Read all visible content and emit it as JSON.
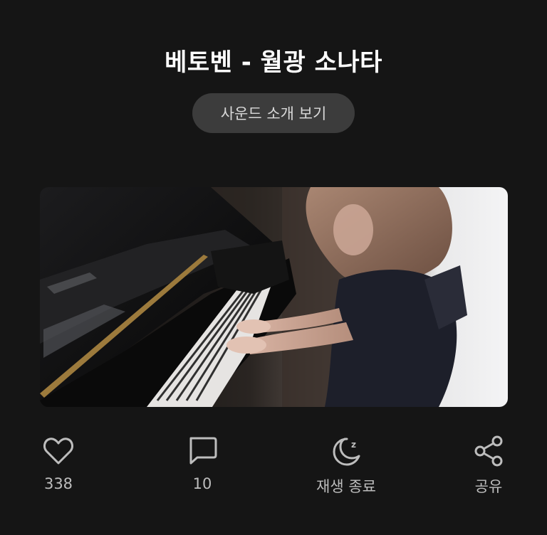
{
  "title": "베토벤 - 월광 소나타",
  "intro_button_label": "사운드 소개 보기",
  "image": {
    "subject": "piano-player-photo"
  },
  "actions": [
    {
      "icon": "heart-icon",
      "label": "338"
    },
    {
      "icon": "comment-icon",
      "label": "10"
    },
    {
      "icon": "sleep-timer-icon",
      "label": "재생 종료"
    },
    {
      "icon": "share-icon",
      "label": "공유"
    }
  ],
  "colors": {
    "background": "#151515",
    "button_bg": "#3c3c3c",
    "icon": "#bdbdbd",
    "text": "#ffffff"
  }
}
